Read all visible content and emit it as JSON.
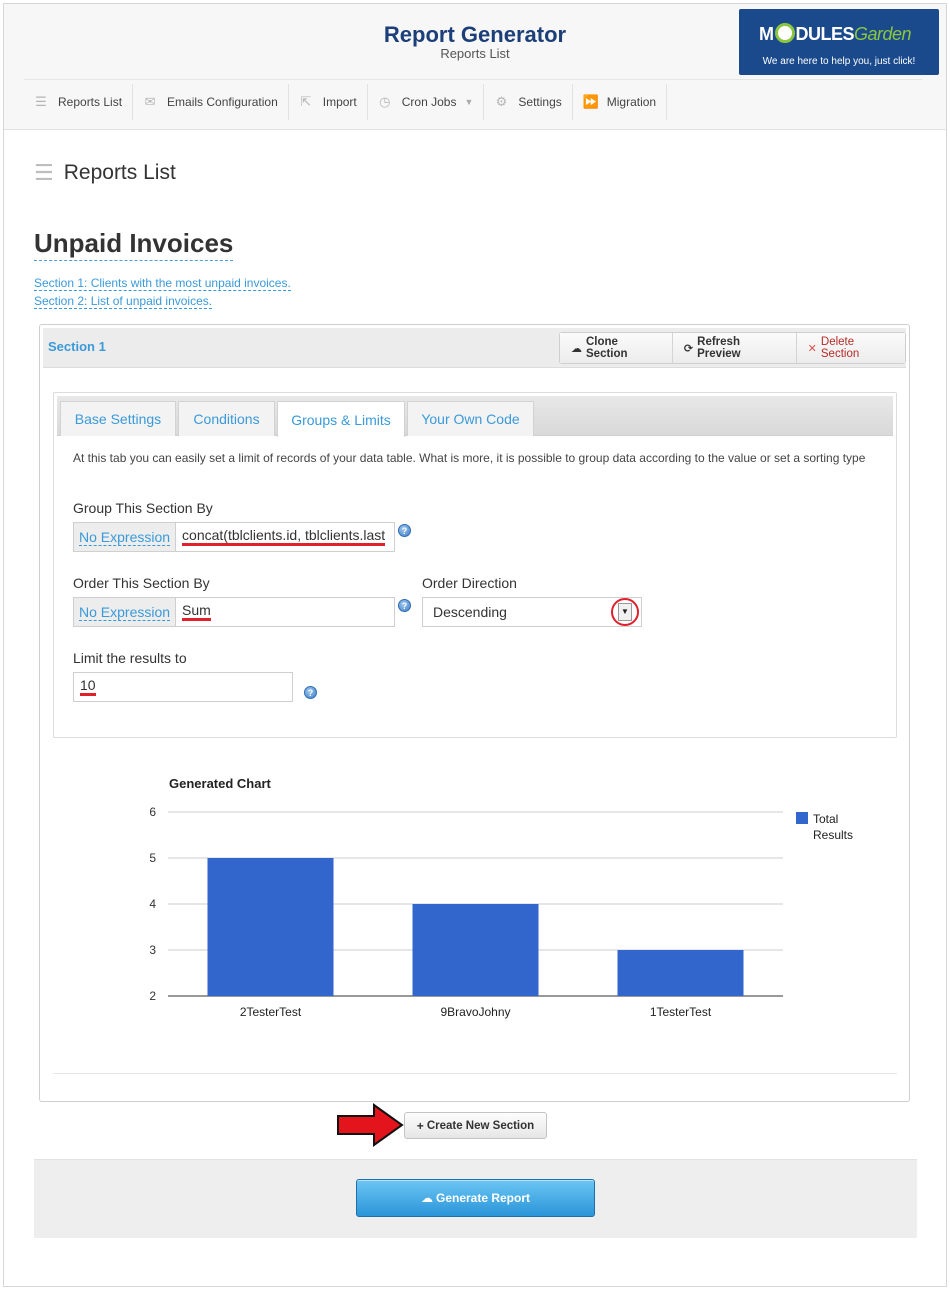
{
  "header": {
    "title": "Report Generator",
    "subtitle": "Reports List",
    "logo": {
      "brand_bold": "MODULES",
      "brand_light": "Garden",
      "tagline": "We are here to help you, just click!"
    }
  },
  "nav": {
    "items": [
      {
        "label": "Reports List",
        "icon": "list-icon"
      },
      {
        "label": "Emails Configuration",
        "icon": "envelope-icon"
      },
      {
        "label": "Import",
        "icon": "share-icon"
      },
      {
        "label": "Cron Jobs",
        "icon": "clock-icon",
        "dropdown": true
      },
      {
        "label": "Settings",
        "icon": "gears-icon"
      },
      {
        "label": "Migration",
        "icon": "forward-icon"
      }
    ]
  },
  "page": {
    "title": "Reports List",
    "report_name": "Unpaid Invoices",
    "section_links": [
      "Section 1: Clients with the most unpaid invoices.",
      "Section 2: List of unpaid invoices."
    ]
  },
  "section": {
    "title": "Section 1",
    "buttons": {
      "clone": "Clone Section",
      "refresh": "Refresh Preview",
      "delete": "Delete Section"
    },
    "tabs": [
      "Base Settings",
      "Conditions",
      "Groups & Limits",
      "Your Own Code"
    ],
    "active_tab": "Groups & Limits",
    "description": "At this tab you can easily set a limit of records of your data table. What is more, it is possible to group data according to the value or set a sorting type",
    "group_by": {
      "label": "Group This Section By",
      "addon": "No Expression",
      "value": "concat(tblclients.id, tblclients.last"
    },
    "order_by": {
      "label": "Order This Section By",
      "addon": "No Expression",
      "value": "Sum"
    },
    "order_direction": {
      "label": "Order Direction",
      "value": "Descending"
    },
    "limit": {
      "label": "Limit the results to",
      "value": "10"
    }
  },
  "chart_data": {
    "type": "bar",
    "title": "Generated Chart",
    "categories": [
      "2TesterTest",
      "9BravoJohny",
      "1TesterTest"
    ],
    "series": [
      {
        "name": "Total Results",
        "values": [
          5,
          4,
          3
        ]
      }
    ],
    "ylim": [
      2,
      6
    ],
    "yticks": [
      2,
      3,
      4,
      5,
      6
    ],
    "legend_position": "right",
    "grid": true,
    "color": "#3366cc"
  },
  "actions": {
    "create_section": "Create New Section",
    "generate_report": "Generate Report"
  }
}
